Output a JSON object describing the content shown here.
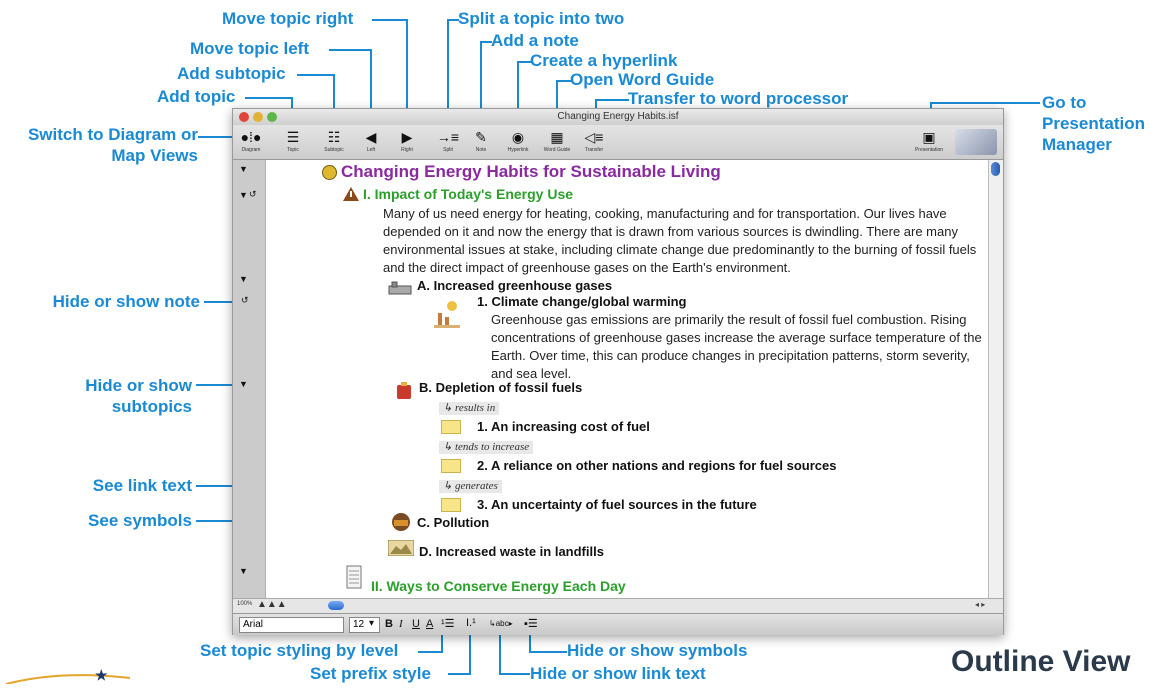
{
  "callouts": {
    "move_right": "Move topic right",
    "move_left": "Move topic left",
    "add_subtopic": "Add subtopic",
    "add_topic": "Add topic",
    "switch_line1": "Switch to Diagram or",
    "switch_line2": "Map Views",
    "split": "Split a topic into two",
    "add_note": "Add a note",
    "hyperlink": "Create a hyperlink",
    "word_guide": "Open Word Guide",
    "transfer": "Transfer to word processor",
    "goto_line1": "Go to",
    "goto_line2": "Presentation",
    "goto_line3": "Manager",
    "hide_note": "Hide or show note",
    "hide_sub_line1": "Hide or show",
    "hide_sub_line2": "subtopics",
    "see_link": "See link text",
    "see_symbols": "See symbols",
    "styling_level": "Set topic styling by level",
    "prefix_style": "Set prefix style",
    "hide_symbols": "Hide or show symbols",
    "hide_link_text": "Hide or show link text"
  },
  "footer_title": "Outline View",
  "window": {
    "title": "Changing Energy Habits.isf"
  },
  "toolbar": {
    "diagram": "Diagram",
    "topic": "Topic",
    "subtopic": "Subtopic",
    "left": "Left",
    "right": "Right",
    "split": "Split",
    "note": "Note",
    "hyperlink": "Hyperlink",
    "word_guide": "Word Guide",
    "transfer": "Transfer",
    "presentation": "Presentation"
  },
  "outline": {
    "main_title": "Changing Energy Habits for Sustainable Living",
    "topic1": "I. Impact of Today's Energy Use",
    "topic1_note": "Many of us need energy for heating, cooking, manufacturing and for transportation. Our lives have depended on it and now the energy that is drawn from various sources is dwindling. There are many environmental issues at stake, including climate change due predominantly to the burning of fossil fuels and the direct impact of greenhouse gases on the Earth's environment.",
    "subA": "A. Increased greenhouse gases",
    "subA1": "1. Climate change/global warming",
    "subA1_note": "Greenhouse gas emissions are primarily the result of fossil fuel combustion. Rising concentrations of greenhouse gases increase the average surface temperature of the Earth. Over time, this can produce changes in precipitation patterns, storm severity, and sea level.",
    "subB": "B. Depletion of fossil fuels",
    "link1": "results in",
    "subB1": "1. An increasing cost of fuel",
    "link2": "tends to increase",
    "subB2": "2. A reliance on other nations and regions for fuel sources",
    "link3": "generates",
    "subB3": "3. An uncertainty of fuel sources in the future",
    "subC": "C. Pollution",
    "subD": "D. Increased waste in landfills",
    "topic2": "II. Ways to Conserve Energy Each Day"
  },
  "formatbar": {
    "zoom": "100%",
    "font": "Arial",
    "size": "12",
    "bold": "B",
    "italic": "I",
    "underline": "U",
    "color": "A",
    "link_toggle": "abc"
  },
  "colors": {
    "callout": "#1a8ad4",
    "title_purple": "#8a2aa0",
    "topic_green": "#2aa02a",
    "footer": "#2a3a4a"
  }
}
